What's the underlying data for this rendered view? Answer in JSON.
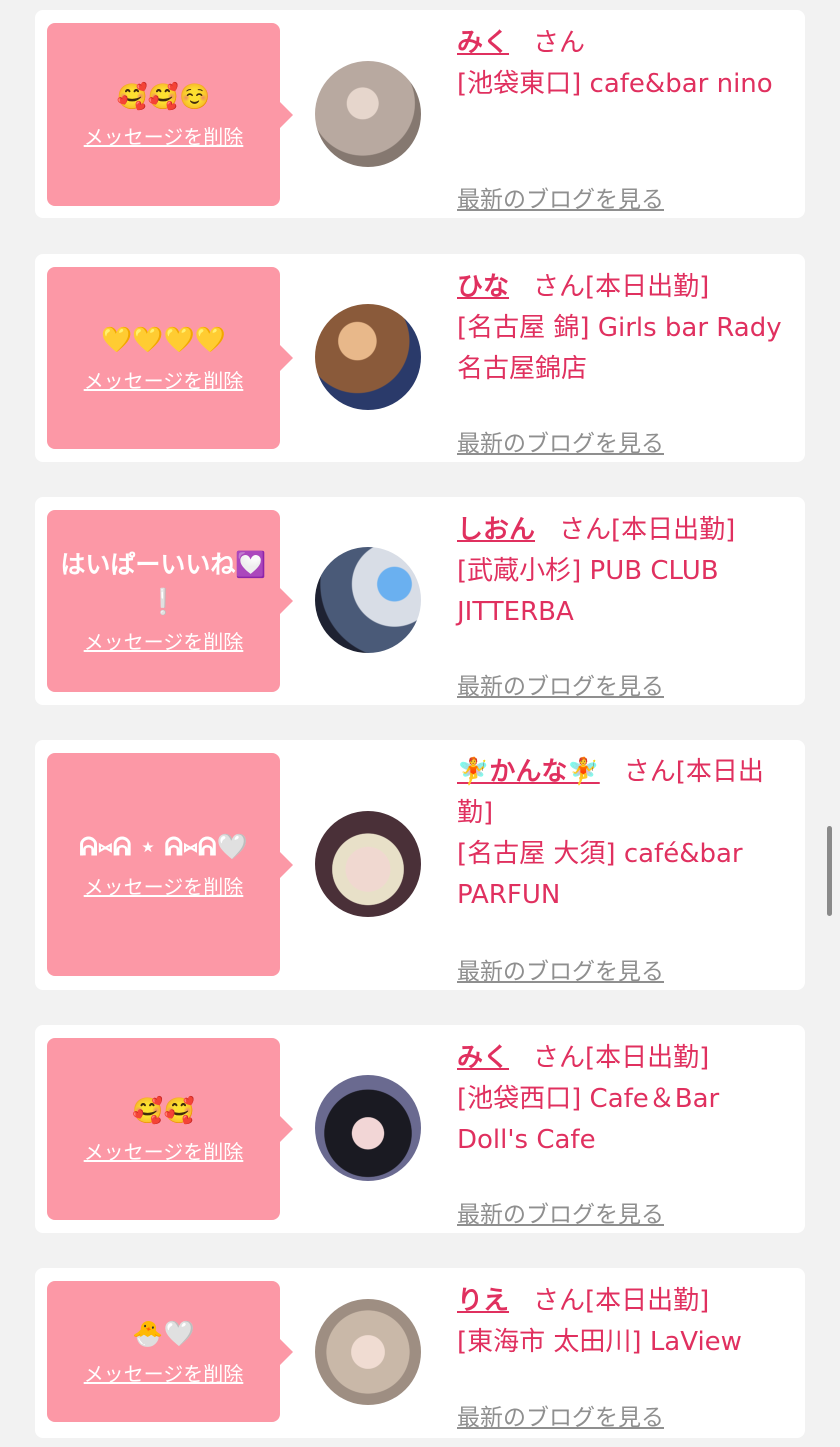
{
  "items": [
    {
      "message": "🥰🥰☺️",
      "delete_label": "メッセージを削除",
      "name": "みく",
      "suffix": "さん",
      "shop": "[池袋東口] cafe&bar nino",
      "blog_label": "最新のブログを見る",
      "avatar_color": "#b8a9a0"
    },
    {
      "message": "💛💛💛💛",
      "delete_label": "メッセージを削除",
      "name": "ひな",
      "suffix": "さん[本日出勤]",
      "shop": "[名古屋 錦] Girls bar Rady 名古屋錦店",
      "blog_label": "最新のブログを見る",
      "avatar_color": "#6b4a3a"
    },
    {
      "message": "はいぱーいいね💟❕",
      "delete_label": "メッセージを削除",
      "name": "しおん",
      "suffix": "さん[本日出勤]",
      "shop": "[武蔵小杉] PUB CLUB JITTERBA",
      "blog_label": "最新のブログを見る",
      "avatar_color": "#4a5a78"
    },
    {
      "message": "ᕱ⑅ᕱ ⋆ ᕱ⑅ᕱ🤍",
      "delete_label": "メッセージを削除",
      "name": "🧚かんな🧚",
      "suffix": "さん[本日出勤]",
      "shop": "[名古屋 大須] café&bar PARFUN",
      "blog_label": "最新のブログを見る",
      "avatar_color": "#7a5a6a"
    },
    {
      "message": "🥰🥰",
      "delete_label": "メッセージを削除",
      "name": "みく",
      "suffix": "さん[本日出勤]",
      "shop": "[池袋西口] Cafe＆Bar Doll's Cafe",
      "blog_label": "最新のブログを見る",
      "avatar_color": "#3a3348"
    },
    {
      "message": "🐣🤍",
      "delete_label": "メッセージを削除",
      "name": "りえ",
      "suffix": "さん[本日出勤]",
      "shop": "[東海市 太田川] LaView",
      "blog_label": "最新のブログを見る",
      "avatar_color": "#b9a89c"
    }
  ]
}
